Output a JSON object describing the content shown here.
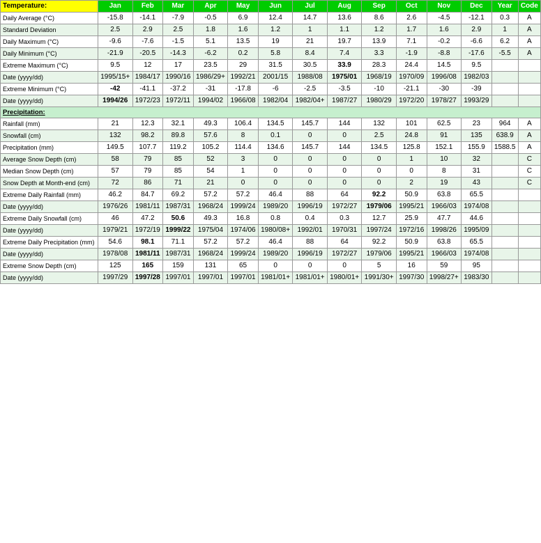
{
  "headers": {
    "col0": "Temperature:",
    "jan": "Jan",
    "feb": "Feb",
    "mar": "Mar",
    "apr": "Apr",
    "may": "May",
    "jun": "Jun",
    "jul": "Jul",
    "aug": "Aug",
    "sep": "Sep",
    "oct": "Oct",
    "nov": "Nov",
    "dec": "Dec",
    "year": "Year",
    "code": "Code"
  },
  "rows": [
    {
      "label": "Daily Average (°C)",
      "jan": "-15.8",
      "feb": "-14.1",
      "mar": "-7.9",
      "apr": "-0.5",
      "may": "6.9",
      "jun": "12.4",
      "jul": "14.7",
      "aug": "13.6",
      "sep": "8.6",
      "oct": "2.6",
      "nov": "-4.5",
      "dec": "-12.1",
      "year": "0.3",
      "code": "A",
      "bg": "light"
    },
    {
      "label": "Standard Deviation",
      "jan": "2.5",
      "feb": "2.9",
      "mar": "2.5",
      "apr": "1.8",
      "may": "1.6",
      "jun": "1.2",
      "jul": "1",
      "aug": "1.1",
      "sep": "1.2",
      "oct": "1.7",
      "nov": "1.6",
      "dec": "2.9",
      "year": "1",
      "code": "A",
      "bg": "green"
    },
    {
      "label": "Daily Maximum (°C)",
      "jan": "-9.6",
      "feb": "-7.6",
      "mar": "-1.5",
      "apr": "5.1",
      "may": "13.5",
      "jun": "19",
      "jul": "21",
      "aug": "19.7",
      "sep": "13.9",
      "oct": "7.1",
      "nov": "-0.2",
      "dec": "-6.6",
      "year": "6.2",
      "code": "A",
      "bg": "light"
    },
    {
      "label": "Daily Minimum (°C)",
      "jan": "-21.9",
      "feb": "-20.5",
      "mar": "-14.3",
      "apr": "-6.2",
      "may": "0.2",
      "jun": "5.8",
      "jul": "8.4",
      "aug": "7.4",
      "sep": "3.3",
      "oct": "-1.9",
      "nov": "-8.8",
      "dec": "-17.6",
      "year": "-5.5",
      "code": "A",
      "bg": "green"
    },
    {
      "label": "Extreme Maximum (°C)",
      "jan": "9.5",
      "feb": "12",
      "mar": "17",
      "apr": "23.5",
      "may": "29",
      "jun": "31.5",
      "jul": "30.5",
      "aug": "33.9",
      "sep": "28.3",
      "oct": "24.4",
      "nov": "14.5",
      "dec": "9.5",
      "year": "",
      "code": "",
      "bg": "light",
      "bold_aug": true
    },
    {
      "label": "Date (yyyy/dd)",
      "jan": "1995/15+",
      "feb": "1984/17",
      "mar": "1990/16",
      "apr": "1986/29+",
      "may": "1992/21",
      "jun": "2001/15",
      "jul": "1988/08",
      "aug": "1975/01",
      "sep": "1968/19",
      "oct": "1970/09",
      "nov": "1996/08",
      "dec": "1982/03",
      "year": "",
      "code": "",
      "bg": "green",
      "bold_aug": true
    },
    {
      "label": "Extreme Minimum (°C)",
      "jan": "-42",
      "feb": "-41.1",
      "mar": "-37.2",
      "apr": "-31",
      "may": "-17.8",
      "jun": "-6",
      "jul": "-2.5",
      "aug": "-3.5",
      "sep": "-10",
      "oct": "-21.1",
      "nov": "-30",
      "dec": "-39",
      "year": "",
      "code": "",
      "bg": "light",
      "bold_jan": true
    },
    {
      "label": "Date (yyyy/dd)",
      "jan": "1994/26",
      "feb": "1972/23",
      "mar": "1972/11",
      "apr": "1994/02",
      "may": "1966/08",
      "jun": "1982/04",
      "jul": "1982/04+",
      "aug": "1987/27",
      "sep": "1980/29",
      "oct": "1972/20",
      "nov": "1978/27",
      "dec": "1993/29",
      "year": "",
      "code": "",
      "bg": "green",
      "bold_jan": true
    },
    {
      "label": "Precipitation:",
      "section": true
    },
    {
      "label": "Rainfall (mm)",
      "jan": "21",
      "feb": "12.3",
      "mar": "32.1",
      "apr": "49.3",
      "may": "106.4",
      "jun": "134.5",
      "jul": "145.7",
      "aug": "144",
      "sep": "132",
      "oct": "101",
      "nov": "62.5",
      "dec": "23",
      "year": "964",
      "code": "A",
      "bg": "light"
    },
    {
      "label": "Snowfall (cm)",
      "jan": "132",
      "feb": "98.2",
      "mar": "89.8",
      "apr": "57.6",
      "may": "8",
      "jun": "0.1",
      "jul": "0",
      "aug": "0",
      "sep": "2.5",
      "oct": "24.8",
      "nov": "91",
      "dec": "135",
      "year": "638.9",
      "code": "A",
      "bg": "green"
    },
    {
      "label": "Precipitation (mm)",
      "jan": "149.5",
      "feb": "107.7",
      "mar": "119.2",
      "apr": "105.2",
      "may": "114.4",
      "jun": "134.6",
      "jul": "145.7",
      "aug": "144",
      "sep": "134.5",
      "oct": "125.8",
      "nov": "152.1",
      "dec": "155.9",
      "year": "1588.5",
      "code": "A",
      "bg": "light"
    },
    {
      "label": "Average Snow Depth (cm)",
      "jan": "58",
      "feb": "79",
      "mar": "85",
      "apr": "52",
      "may": "3",
      "jun": "0",
      "jul": "0",
      "aug": "0",
      "sep": "0",
      "oct": "1",
      "nov": "10",
      "dec": "32",
      "year": "",
      "code": "C",
      "bg": "green"
    },
    {
      "label": "Median Snow Depth (cm)",
      "jan": "57",
      "feb": "79",
      "mar": "85",
      "apr": "54",
      "may": "1",
      "jun": "0",
      "jul": "0",
      "aug": "0",
      "sep": "0",
      "oct": "0",
      "nov": "8",
      "dec": "31",
      "year": "",
      "code": "C",
      "bg": "light"
    },
    {
      "label": "Snow Depth at Month-end (cm)",
      "jan": "72",
      "feb": "86",
      "mar": "71",
      "apr": "21",
      "may": "0",
      "jun": "0",
      "jul": "0",
      "aug": "0",
      "sep": "0",
      "oct": "2",
      "nov": "19",
      "dec": "43",
      "year": "",
      "code": "C",
      "bg": "green"
    },
    {
      "label": "Extreme Daily Rainfall (mm)",
      "jan": "46.2",
      "feb": "84.7",
      "mar": "69.2",
      "apr": "57.2",
      "may": "57.2",
      "jun": "46.4",
      "jul": "88",
      "aug": "64",
      "sep": "92.2",
      "oct": "50.9",
      "nov": "63.8",
      "dec": "65.5",
      "year": "",
      "code": "",
      "bg": "light",
      "bold_sep": true
    },
    {
      "label": "Date (yyyy/dd)",
      "jan": "1976/26",
      "feb": "1981/11",
      "mar": "1987/31",
      "apr": "1968/24",
      "may": "1999/24",
      "jun": "1989/20",
      "jul": "1996/19",
      "aug": "1972/27",
      "sep": "1979/06",
      "oct": "1995/21",
      "nov": "1966/03",
      "dec": "1974/08",
      "year": "",
      "code": "",
      "bg": "green",
      "bold_sep": true
    },
    {
      "label": "Extreme Daily Snowfall (cm)",
      "jan": "46",
      "feb": "47.2",
      "mar": "50.6",
      "apr": "49.3",
      "may": "16.8",
      "jun": "0.8",
      "jul": "0.4",
      "aug": "0.3",
      "sep": "12.7",
      "oct": "25.9",
      "nov": "47.7",
      "dec": "44.6",
      "year": "",
      "code": "",
      "bg": "light",
      "bold_mar": true
    },
    {
      "label": "Date (yyyy/dd)",
      "jan": "1979/21",
      "feb": "1972/19",
      "mar": "1999/22",
      "apr": "1975/04",
      "may": "1974/06",
      "jun": "1980/08+",
      "jul": "1992/01",
      "aug": "1970/31",
      "sep": "1997/24",
      "oct": "1972/16",
      "nov": "1998/26",
      "dec": "1995/09",
      "year": "",
      "code": "",
      "bg": "green",
      "bold_mar": true
    },
    {
      "label": "Extreme Daily Precipitation (mm)",
      "jan": "54.6",
      "feb": "98.1",
      "mar": "71.1",
      "apr": "57.2",
      "may": "57.2",
      "jun": "46.4",
      "jul": "88",
      "aug": "64",
      "sep": "92.2",
      "oct": "50.9",
      "nov": "63.8",
      "dec": "65.5",
      "year": "",
      "code": "",
      "bg": "light",
      "bold_feb": true
    },
    {
      "label": "Date (yyyy/dd)",
      "jan": "1978/08",
      "feb": "1981/11",
      "mar": "1987/31",
      "apr": "1968/24",
      "may": "1999/24",
      "jun": "1989/20",
      "jul": "1996/19",
      "aug": "1972/27",
      "sep": "1979/06",
      "oct": "1995/21",
      "nov": "1966/03",
      "dec": "1974/08",
      "year": "",
      "code": "",
      "bg": "green",
      "bold_feb": true
    },
    {
      "label": "Extreme Snow Depth (cm)",
      "jan": "125",
      "feb": "165",
      "mar": "159",
      "apr": "131",
      "may": "65",
      "jun": "0",
      "jul": "0",
      "aug": "0",
      "sep": "5",
      "oct": "16",
      "nov": "59",
      "dec": "95",
      "year": "",
      "code": "",
      "bg": "light",
      "bold_feb": true
    },
    {
      "label": "Date (yyyy/dd)",
      "jan": "1997/29",
      "feb": "1997/28",
      "mar": "1997/01",
      "apr": "1997/01",
      "may": "1997/01",
      "jun": "1981/01+",
      "jul": "1981/01+",
      "aug": "1980/01+",
      "sep": "1991/30+",
      "oct": "1997/30",
      "nov": "1998/27+",
      "dec": "1983/30",
      "year": "",
      "code": "",
      "bg": "green",
      "bold_feb": true
    }
  ]
}
